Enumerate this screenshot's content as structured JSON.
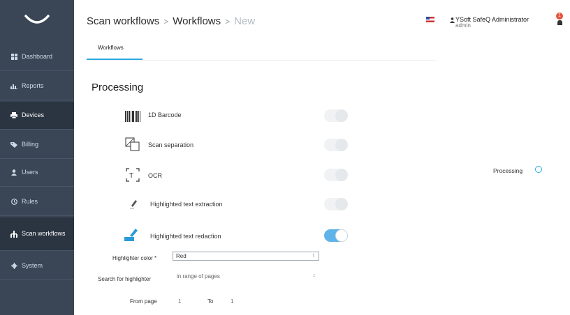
{
  "sidebar": {
    "items": [
      {
        "label": "Dashboard",
        "icon": "dashboard-icon"
      },
      {
        "label": "Reports",
        "icon": "chart-icon"
      },
      {
        "label": "Devices",
        "icon": "printer-icon"
      },
      {
        "label": "Billing",
        "icon": "tag-icon"
      },
      {
        "label": "Users",
        "icon": "user-icon"
      },
      {
        "label": "Rules",
        "icon": "clock-icon"
      },
      {
        "label": "Scan workflows",
        "icon": "scan-workflows-icon"
      },
      {
        "label": "System",
        "icon": "gear-icon"
      }
    ],
    "active_index": 6
  },
  "header": {
    "breadcrumb": [
      "Scan workflows",
      "Workflows",
      "New"
    ],
    "user_name": "YSoft SafeQ Administrator",
    "user_role": "admin",
    "notifications": "1"
  },
  "tabs": {
    "active": "Workflows"
  },
  "processing": {
    "title": "Processing",
    "rows": [
      {
        "label": "1D Barcode",
        "enabled": false
      },
      {
        "label": "Scan separation",
        "enabled": false
      },
      {
        "label": "OCR",
        "enabled": false
      },
      {
        "label": "Highlighted text extraction",
        "enabled": false
      },
      {
        "label": "Highlighted text redaction",
        "enabled": true
      }
    ]
  },
  "form": {
    "highlighter_color_label": "Highlighter color *",
    "highlighter_color_value": "Red",
    "search_label": "Search for highlighter",
    "search_value": "in range of pages",
    "from_page_label": "From page",
    "from_page_value": "1",
    "to_label": "To",
    "to_value": "1"
  },
  "steps": {
    "current": "Processing"
  },
  "colors": {
    "sidebar": "#3a4656",
    "accent": "#29a8e0",
    "toggle_on": "#5fb3e8"
  }
}
